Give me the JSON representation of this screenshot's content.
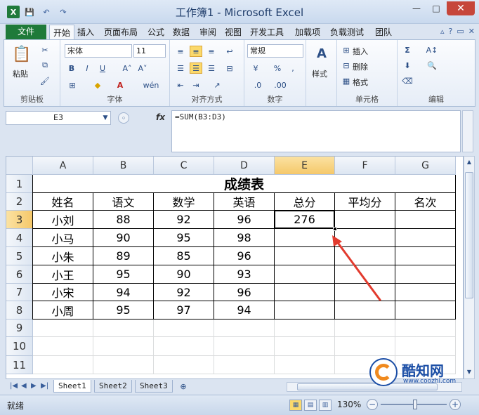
{
  "window": {
    "title": "工作簿1 - Microsoft Excel",
    "minimize": "—",
    "maximize": "□",
    "close": "✕",
    "qat_logo": "X",
    "qat_save": "💾",
    "qat_undo": "↶",
    "qat_redo": "↷"
  },
  "ribbon_tabs": {
    "file": "文件",
    "items": [
      "开始",
      "插入",
      "页面布局",
      "公式",
      "数据",
      "审阅",
      "视图",
      "开发工具",
      "加载项",
      "负载测试",
      "团队"
    ],
    "active": "开始",
    "help": "?"
  },
  "ribbon": {
    "clipboard": {
      "label": "剪贴板",
      "paste": "粘贴"
    },
    "font": {
      "label": "字体",
      "font_name": "宋体",
      "font_size": "11",
      "bold": "B",
      "italic": "I",
      "underline": "U",
      "grow": "A˄",
      "shrink": "A˅",
      "phonetic": "wén"
    },
    "alignment": {
      "label": "对齐方式"
    },
    "number": {
      "label": "数字",
      "format": "常规",
      "percent": "%",
      "comma": ","
    },
    "styles": {
      "label": "样式",
      "button": "样式"
    },
    "cells": {
      "label": "单元格",
      "insert": "插入",
      "delete": "删除",
      "format": "格式"
    },
    "editing": {
      "label": "编辑",
      "sum": "Σ"
    }
  },
  "formula_bar": {
    "name_box": "E3",
    "fx": "fx",
    "formula": "=SUM(B3:D3)"
  },
  "sheet": {
    "columns": [
      "A",
      "B",
      "C",
      "D",
      "E",
      "F",
      "G"
    ],
    "selected_column": "E",
    "rows": [
      "1",
      "2",
      "3",
      "4",
      "5",
      "6",
      "7",
      "8",
      "9",
      "10",
      "11"
    ],
    "selected_row": "3",
    "title": "成绩表",
    "headers": [
      "姓名",
      "语文",
      "数学",
      "英语",
      "总分",
      "平均分",
      "名次"
    ],
    "records": [
      [
        "小刘",
        "88",
        "92",
        "96",
        "276",
        "",
        ""
      ],
      [
        "小马",
        "90",
        "95",
        "98",
        "",
        "",
        ""
      ],
      [
        "小朱",
        "89",
        "85",
        "96",
        "",
        "",
        ""
      ],
      [
        "小王",
        "95",
        "90",
        "93",
        "",
        "",
        ""
      ],
      [
        "小宋",
        "94",
        "92",
        "96",
        "",
        "",
        ""
      ],
      [
        "小周",
        "95",
        "97",
        "94",
        "",
        "",
        ""
      ]
    ],
    "active_cell": "E3"
  },
  "sheet_tabs": {
    "tabs": [
      "Sheet1",
      "Sheet2",
      "Sheet3"
    ],
    "active": "Sheet1",
    "nav": [
      "|◀",
      "◀",
      "▶",
      "▶|"
    ]
  },
  "status": {
    "ready": "就绪",
    "zoom": "130%",
    "zoom_minus": "−",
    "zoom_plus": "+"
  },
  "watermark": {
    "brand": "酷知网",
    "url": "www.coozhi.com"
  },
  "colors": {
    "file_tab": "#1f7a3a",
    "annotation_arrow": "#e23b2e",
    "selection_highlight": "#f5c86a",
    "watermark_blue": "#1b4ea6",
    "watermark_orange": "#f08a1f"
  }
}
